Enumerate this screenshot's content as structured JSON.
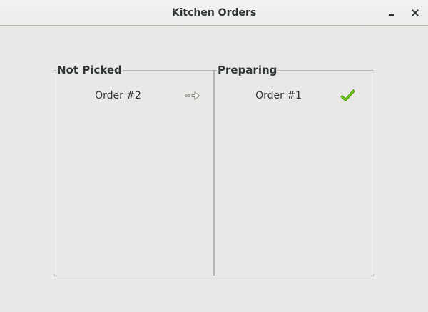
{
  "window": {
    "title": "Kitchen Orders",
    "minimize_icon": "minimize-icon",
    "close_icon": "close-icon"
  },
  "columns": [
    {
      "title": "Not Picked",
      "orders": [
        {
          "label": "Order #2",
          "action_icon": "forward-arrow-icon"
        }
      ]
    },
    {
      "title": "Preparing",
      "orders": [
        {
          "label": "Order #1",
          "action_icon": "checkmark-icon"
        }
      ]
    }
  ],
  "colors": {
    "check_green": "#73d216",
    "check_dark": "#4e9a06",
    "arrow_grey": "#888a85"
  }
}
